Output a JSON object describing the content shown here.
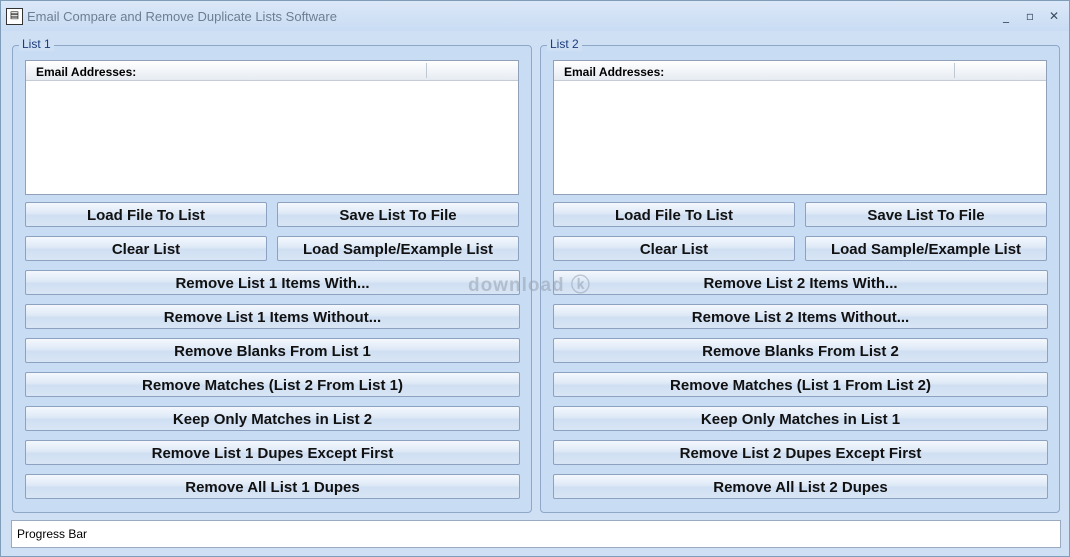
{
  "window": {
    "title": "Email Compare and Remove Duplicate Lists Software",
    "app_icon": "floppy-icon",
    "minimize_glyph": "▭",
    "maximize_glyph": "▭",
    "close_glyph": "✕"
  },
  "list1": {
    "legend": "List 1",
    "column_header": "Email Addresses:",
    "load_file": "Load File To List",
    "save_list": "Save List To File",
    "clear_list": "Clear List",
    "load_sample": "Load Sample/Example List",
    "remove_with": "Remove List 1 Items With...",
    "remove_without": "Remove List 1 Items Without...",
    "remove_blanks": "Remove Blanks From List 1",
    "remove_matches": "Remove Matches (List 2 From List 1)",
    "keep_matches": "Keep Only Matches in List 2",
    "remove_dupes_except_first": "Remove List 1 Dupes Except First",
    "remove_all_dupes": "Remove All List 1 Dupes"
  },
  "list2": {
    "legend": "List 2",
    "column_header": "Email Addresses:",
    "load_file": "Load File To List",
    "save_list": "Save List To File",
    "clear_list": "Clear List",
    "load_sample": "Load Sample/Example List",
    "remove_with": "Remove List 2 Items With...",
    "remove_without": "Remove List 2 Items Without...",
    "remove_blanks": "Remove Blanks From List 2",
    "remove_matches": "Remove Matches (List 1 From List 2)",
    "keep_matches": "Keep Only Matches in List 1",
    "remove_dupes_except_first": "Remove List 2 Dupes Except First",
    "remove_all_dupes": "Remove All List 2 Dupes"
  },
  "watermark": "download ⓚ",
  "progress": {
    "label": "Progress Bar"
  }
}
